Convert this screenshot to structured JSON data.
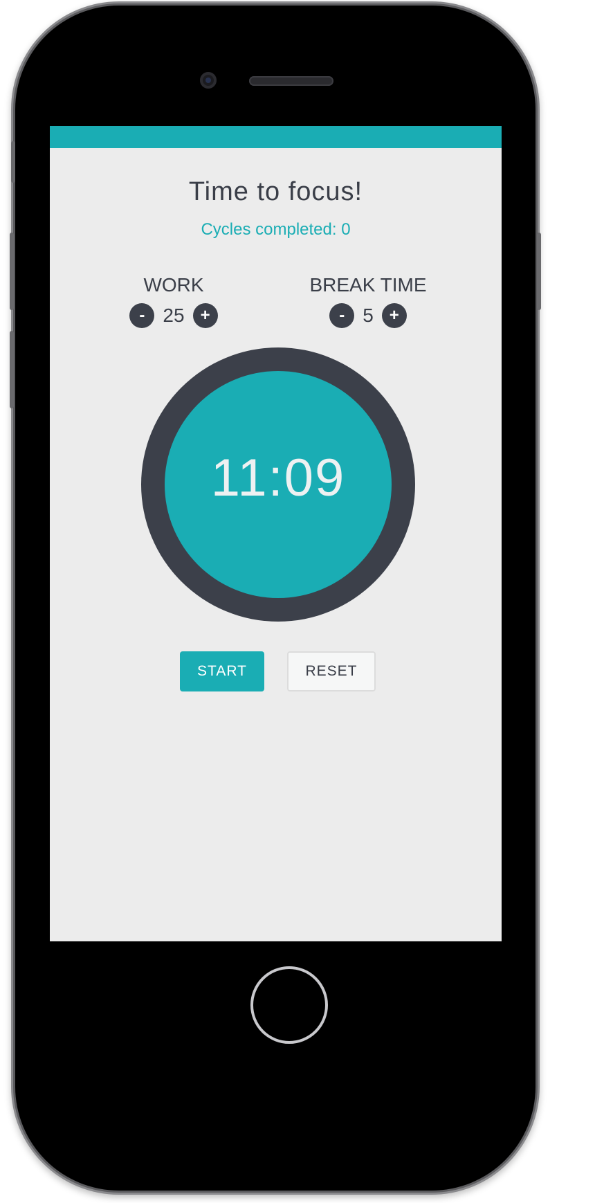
{
  "header": {
    "title": "Time to focus!",
    "cycles_text": "Cycles completed: 0"
  },
  "settings": {
    "work": {
      "label": "WORK",
      "value": "25",
      "decrement": "-",
      "increment": "+"
    },
    "break": {
      "label": "BREAK TIME",
      "value": "5",
      "decrement": "-",
      "increment": "+"
    }
  },
  "timer": {
    "display": "11:09"
  },
  "actions": {
    "start_label": "START",
    "reset_label": "RESET"
  },
  "colors": {
    "accent": "#1aadb4",
    "dark": "#3c404a",
    "background": "#ececec"
  }
}
